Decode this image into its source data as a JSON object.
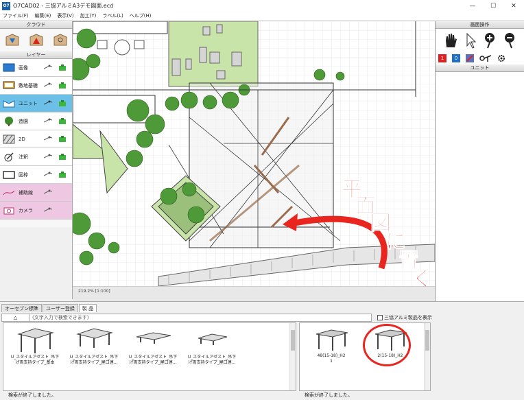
{
  "window": {
    "title": "O7CAD02 - 三協アルミA3デモ図面.ecd",
    "app_icon": "O7",
    "controls": {
      "minimize": "—",
      "maximize": "☐",
      "close": "✕"
    }
  },
  "menu": [
    "ファイル(F)",
    "編集(E)",
    "表示(V)",
    "加工(Y)",
    "ラベル(L)",
    "ヘルプ(H)"
  ],
  "left_panel": {
    "cloud_header": "クラウド",
    "layer_header": "レイヤー",
    "layers": [
      {
        "label": "画像",
        "icon": "image-layer-icon"
      },
      {
        "label": "敷地基礎",
        "icon": "site-foundation-icon"
      },
      {
        "label": "ユニット",
        "icon": "unit-layer-icon",
        "selected": true
      },
      {
        "label": "造園",
        "icon": "landscape-tree-icon"
      },
      {
        "label": "2D",
        "icon": "hatch-2d-icon"
      },
      {
        "label": "注釈",
        "icon": "annotation-icon"
      },
      {
        "label": "図枠",
        "icon": "frame-icon"
      },
      {
        "label": "補助線",
        "icon": "guide-line-icon",
        "pink": true
      },
      {
        "label": "カメラ",
        "icon": "camera-icon",
        "pink": true
      }
    ]
  },
  "canvas": {
    "scale_label": "219.2% [1:100]",
    "annotation": [
      "平",
      "面",
      "図",
      "に",
      "置",
      "く",
      "と"
    ],
    "colors": {
      "annotation": "#e8261f",
      "tree_green": "#4e9a38",
      "lawn": "#c9e4a8"
    }
  },
  "right_panel": {
    "view_header": "画面操作",
    "unit_header": "ユニット",
    "badge_one": "1",
    "badge_zero": "0"
  },
  "bottom": {
    "tabs": [
      "オーセブン標準",
      "ユーザー登録",
      "製 品"
    ],
    "up_button": "△",
    "search_placeholder": "(文字入力で検索できます)",
    "show_product_label": "三協アルミ製品を表示",
    "left_items": [
      {
        "l1": "U_スタイルアゼスト_吊下",
        "l2": "げ両支持タイプ_基本"
      },
      {
        "l1": "U_スタイルアゼスト_吊下",
        "l2": "げ両支持タイプ_屋口連..."
      },
      {
        "l1": "U_スタイルアゼスト_吊下",
        "l2": "げ両支持タイプ_屋口連..."
      },
      {
        "l1": "U_スタイルアゼスト_吊下",
        "l2": "げ両支持タイプ_屋口連..."
      }
    ],
    "right_items": [
      {
        "l1": "48(15-18)_H2",
        "l2": "1"
      },
      {
        "l1": "2(15-18)_H2",
        "l2": ""
      }
    ],
    "status_left": "検索が終了しました。",
    "status_right": "検索が終了しました。"
  }
}
